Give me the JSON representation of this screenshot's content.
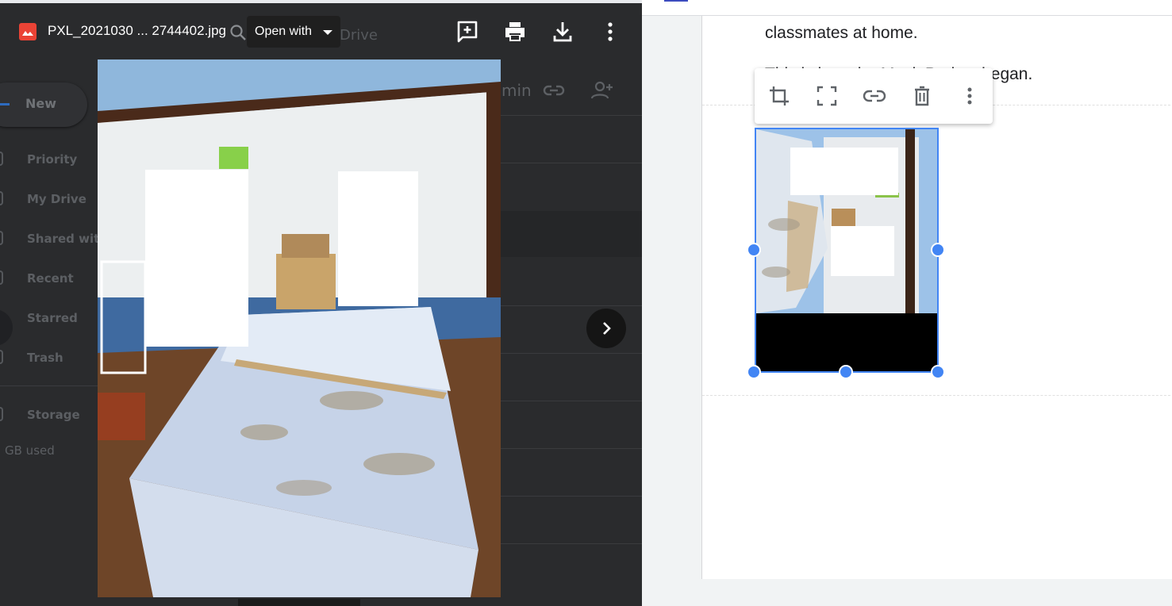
{
  "viewer": {
    "file_name": "PXL_2021030 ... 2744402.jpg",
    "open_with_label": "Open with",
    "actions": [
      "add-comment",
      "print",
      "download",
      "more"
    ]
  },
  "drive_background": {
    "search_fragment": "Drive",
    "breadcrumb_fragment": "min",
    "new_button_label": "New",
    "nav_items": [
      {
        "label": "Priority"
      },
      {
        "label": "My Drive"
      },
      {
        "label": "Shared with"
      },
      {
        "label": "Recent"
      },
      {
        "label": "Starred"
      },
      {
        "label": "Trash"
      }
    ],
    "storage_label": "Storage",
    "storage_used_fragment": "GB used"
  },
  "doc": {
    "line1": "classmates at home.",
    "line2": "This is how the Mask Project began.",
    "image_toolbar": [
      "crop-icon",
      "reset-size-icon",
      "link-icon",
      "delete-icon",
      "more-icon"
    ]
  },
  "colors": {
    "accent_blue": "#4285f4",
    "viewer_bg": "#2a2b2d",
    "file_icon_red": "#ea4335"
  }
}
